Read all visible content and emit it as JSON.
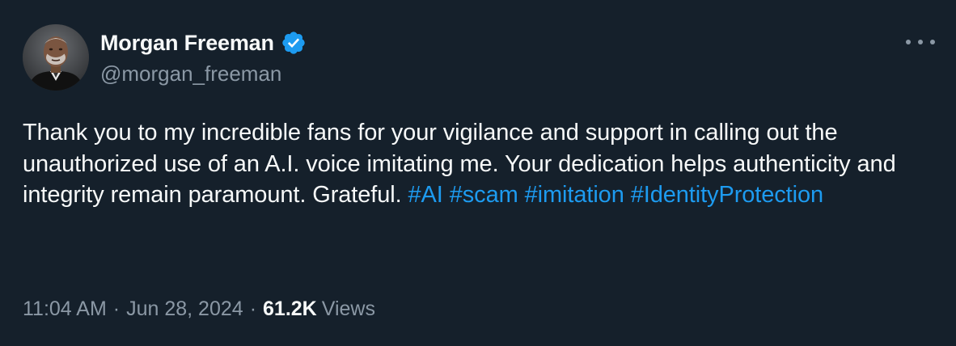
{
  "author": {
    "display_name": "Morgan Freeman",
    "handle": "@morgan_freeman",
    "verified": true,
    "avatar_icon": "profile-photo"
  },
  "more_icon": "ellipsis-icon",
  "tweet": {
    "text_parts": [
      "Thank you to my incredible fans for your vigilance and support in calling out the unauthorized use of an A.I. voice imitating me. Your dedication helps authenticity and integrity remain paramount. Grateful. "
    ],
    "hashtags": [
      "#AI",
      "#scam",
      "#imitation",
      "#IdentityProtection"
    ]
  },
  "meta": {
    "time": "11:04 AM",
    "separator": "·",
    "date": "Jun 28, 2024",
    "views_count": "61.2K",
    "views_label": "Views"
  },
  "colors": {
    "background": "#15202b",
    "text": "#f7f9f9",
    "secondary": "#8b98a5",
    "accent": "#1d9bf0"
  }
}
